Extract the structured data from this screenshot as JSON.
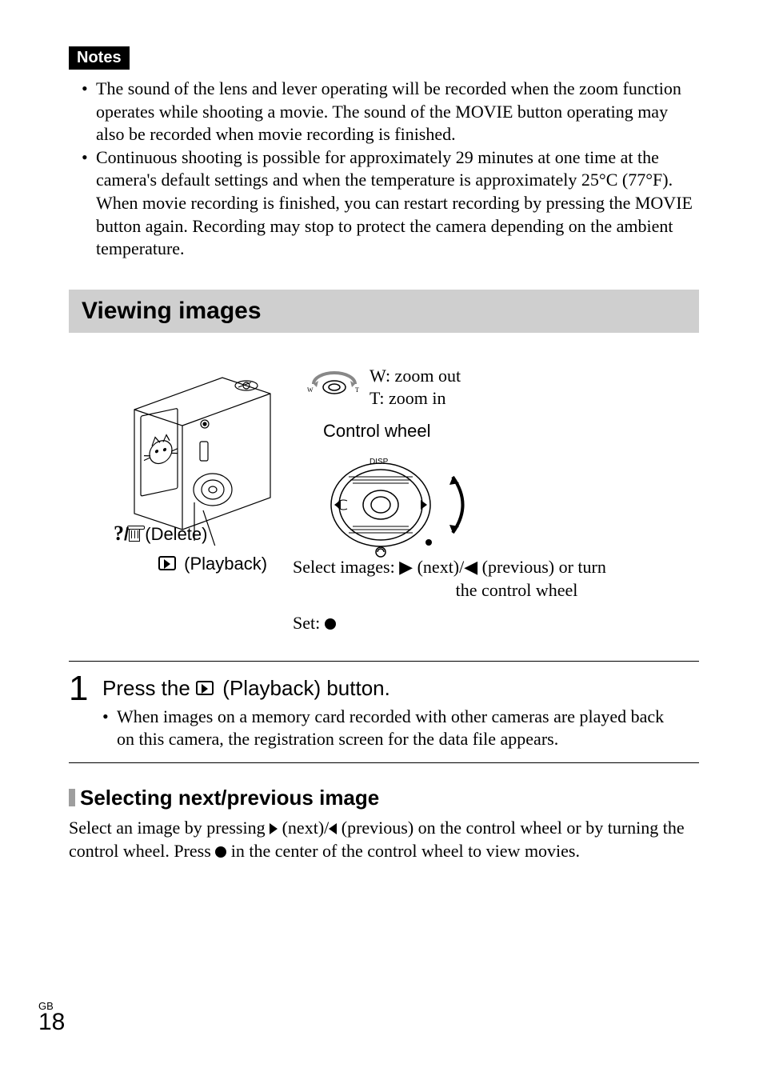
{
  "notes": {
    "badge": "Notes",
    "items": [
      "The sound of the lens and lever operating will be recorded when the zoom function operates while shooting a movie. The sound of the MOVIE button operating may also be recorded when movie recording is finished.",
      "Continuous shooting is possible for approximately 29 minutes at one time at the camera's default settings and when the temperature is approximately 25°C (77°F). When movie recording is finished, you can restart recording by pressing the MOVIE button again. Recording may stop to protect the camera depending on the ambient temperature."
    ]
  },
  "section_title": "Viewing images",
  "figure": {
    "zoom_out": "W: zoom out",
    "zoom_in": "T: zoom in",
    "control_wheel": "Control wheel",
    "delete_prefix": "?",
    "delete_word": " (Delete)",
    "playback_word": " (Playback)",
    "select_images_l1": "Select images: ▶ (next)/◀ (previous) or turn",
    "select_images_l2": "the control wheel",
    "set_label": "Set: "
  },
  "step1": {
    "num": "1",
    "title_prefix": "Press the ",
    "title_suffix": " (Playback) button.",
    "bullet": "When images on a memory card recorded with other cameras are played back on this camera, the registration screen for the data file appears."
  },
  "subsection": {
    "title": "Selecting next/previous image",
    "body_1": "Select an image by pressing ",
    "body_2": " (next)/",
    "body_3": " (previous) on the control wheel or by turning the control wheel. Press ",
    "body_4": " in the center of the control wheel to view movies."
  },
  "footer": {
    "lang": "GB",
    "page": "18"
  }
}
